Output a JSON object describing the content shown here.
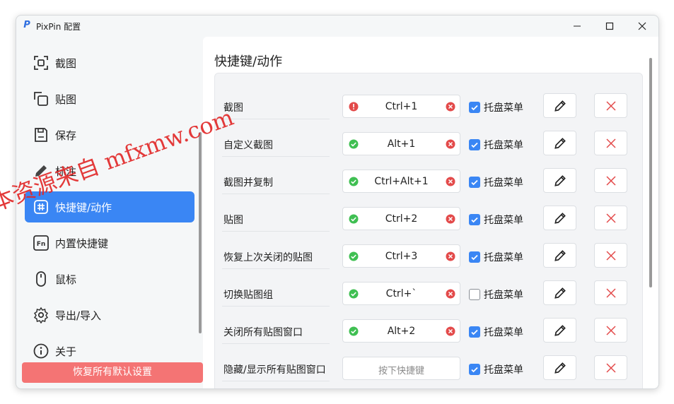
{
  "window": {
    "title": "PixPin 配置",
    "app_icon_letter": "P"
  },
  "sidebar": {
    "items": [
      {
        "label": "截图",
        "icon": "screenshot-icon"
      },
      {
        "label": "贴图",
        "icon": "pin-icon"
      },
      {
        "label": "保存",
        "icon": "save-icon"
      },
      {
        "label": "标注",
        "icon": "pencil-icon"
      },
      {
        "label": "快捷键/动作",
        "icon": "hashtag-icon",
        "active": true
      },
      {
        "label": "内置快捷键",
        "icon": "fn-key-icon"
      },
      {
        "label": "鼠标",
        "icon": "mouse-icon"
      },
      {
        "label": "导出/导入",
        "icon": "gear-icon"
      },
      {
        "label": "关于",
        "icon": "info-icon"
      }
    ],
    "reset_label": "恢复所有默认设置"
  },
  "main": {
    "title": "快捷键/动作",
    "rows": [
      {
        "name": "截图",
        "key": "Ctrl+1",
        "status": "error",
        "tray": true
      },
      {
        "name": "自定义截图",
        "key": "Alt+1",
        "status": "ok",
        "tray": true
      },
      {
        "name": "截图并复制",
        "key": "Ctrl+Alt+1",
        "status": "ok",
        "tray": true
      },
      {
        "name": "贴图",
        "key": "Ctrl+2",
        "status": "ok",
        "tray": true
      },
      {
        "name": "恢复上次关闭的贴图",
        "key": "Ctrl+3",
        "status": "ok",
        "tray": true
      },
      {
        "name": "切换贴图组",
        "key": "Ctrl+`",
        "status": "ok",
        "tray": false
      },
      {
        "name": "关闭所有贴图窗口",
        "key": "Alt+2",
        "status": "ok",
        "tray": true
      },
      {
        "name": "隐藏/显示所有贴图窗口",
        "key": "",
        "placeholder": "按下快捷键",
        "status": "none",
        "tray": true
      }
    ],
    "tray_label": "托盘菜单"
  },
  "watermark": "本资源来自 mfxmw.com",
  "colors": {
    "accent": "#3a86f4",
    "danger": "#e34a4a",
    "ok": "#3fbf52",
    "reset": "#f47474"
  }
}
